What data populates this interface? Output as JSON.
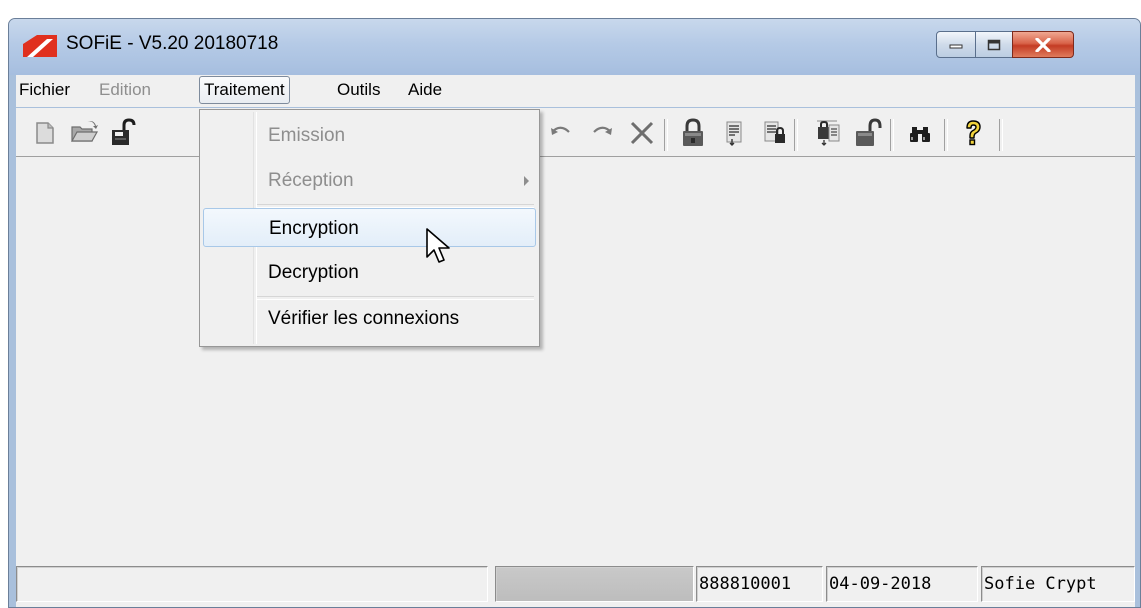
{
  "window": {
    "title": "SOFiE - V5.20 20180718",
    "controls": [
      "minimize-icon",
      "maximize-icon",
      "close-icon"
    ],
    "colors": {
      "titlebar": "#b5cae6",
      "close_button": "#c43c24",
      "logo": "#e0301e"
    }
  },
  "menubar": {
    "items": [
      {
        "label": "Fichier",
        "enabled": true
      },
      {
        "label": "Edition",
        "enabled": false
      },
      {
        "label": "Traitement",
        "enabled": true,
        "open": true
      },
      {
        "label": "Outils",
        "enabled": true
      },
      {
        "label": "Aide",
        "enabled": true
      }
    ]
  },
  "toolbar": {
    "buttons": [
      "new-document-icon",
      "open-folder-icon",
      "open-lock-icon",
      "undo-icon",
      "redo-icon",
      "delete-icon",
      "lock-icon",
      "encrypt-document-icon",
      "encrypt-locked-document-icon",
      "decrypt-document-icon",
      "unlock-icon",
      "binoculars-icon",
      "help-icon"
    ]
  },
  "traitement_menu": {
    "items": [
      {
        "label": "Emission",
        "enabled": false
      },
      {
        "label": "Réception",
        "enabled": false,
        "submenu": true
      },
      {
        "label": "Encryption",
        "enabled": true,
        "hovered": true
      },
      {
        "label": "Decryption",
        "enabled": true
      },
      {
        "label": "Vérifier les connexions",
        "enabled": true
      }
    ]
  },
  "statusbar": {
    "panels": [
      "",
      "",
      "888810001",
      "04-09-2018",
      "Sofie Crypt"
    ]
  }
}
